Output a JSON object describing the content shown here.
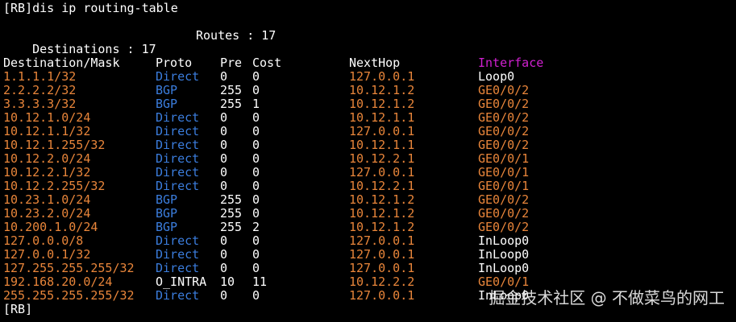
{
  "command_line": "[RB]dis ip routing-table",
  "summary": {
    "destinations": "Destinations : 17",
    "routes": "Routes : 17"
  },
  "headers": {
    "destination": "Destination/Mask",
    "proto": "Proto",
    "pre": "Pre",
    "cost": "Cost",
    "nexthop": "NextHop",
    "interface": "Interface"
  },
  "rows": [
    {
      "dest": "1.1.1.1/32",
      "proto": "Direct",
      "pre": "0",
      "cost": "0",
      "nexthop": "127.0.0.1",
      "iface": "Loop0"
    },
    {
      "dest": "2.2.2.2/32",
      "proto": "BGP",
      "pre": "255",
      "cost": "0",
      "nexthop": "10.12.1.2",
      "iface": "GE0/0/2"
    },
    {
      "dest": "3.3.3.3/32",
      "proto": "BGP",
      "pre": "255",
      "cost": "1",
      "nexthop": "10.12.1.2",
      "iface": "GE0/0/2"
    },
    {
      "dest": "10.12.1.0/24",
      "proto": "Direct",
      "pre": "0",
      "cost": "0",
      "nexthop": "10.12.1.1",
      "iface": "GE0/0/2"
    },
    {
      "dest": "10.12.1.1/32",
      "proto": "Direct",
      "pre": "0",
      "cost": "0",
      "nexthop": "127.0.0.1",
      "iface": "GE0/0/2"
    },
    {
      "dest": "10.12.1.255/32",
      "proto": "Direct",
      "pre": "0",
      "cost": "0",
      "nexthop": "10.12.1.1",
      "iface": "GE0/0/2"
    },
    {
      "dest": "10.12.2.0/24",
      "proto": "Direct",
      "pre": "0",
      "cost": "0",
      "nexthop": "10.12.2.1",
      "iface": "GE0/0/1"
    },
    {
      "dest": "10.12.2.1/32",
      "proto": "Direct",
      "pre": "0",
      "cost": "0",
      "nexthop": "127.0.0.1",
      "iface": "GE0/0/1"
    },
    {
      "dest": "10.12.2.255/32",
      "proto": "Direct",
      "pre": "0",
      "cost": "0",
      "nexthop": "10.12.2.1",
      "iface": "GE0/0/1"
    },
    {
      "dest": "10.23.1.0/24",
      "proto": "BGP",
      "pre": "255",
      "cost": "0",
      "nexthop": "10.12.1.2",
      "iface": "GE0/0/2"
    },
    {
      "dest": "10.23.2.0/24",
      "proto": "BGP",
      "pre": "255",
      "cost": "0",
      "nexthop": "10.12.1.2",
      "iface": "GE0/0/2"
    },
    {
      "dest": "10.200.1.0/24",
      "proto": "BGP",
      "pre": "255",
      "cost": "2",
      "nexthop": "10.12.1.2",
      "iface": "GE0/0/2"
    },
    {
      "dest": "127.0.0.0/8",
      "proto": "Direct",
      "pre": "0",
      "cost": "0",
      "nexthop": "127.0.0.1",
      "iface": "InLoop0"
    },
    {
      "dest": "127.0.0.1/32",
      "proto": "Direct",
      "pre": "0",
      "cost": "0",
      "nexthop": "127.0.0.1",
      "iface": "InLoop0"
    },
    {
      "dest": "127.255.255.255/32",
      "proto": "Direct",
      "pre": "0",
      "cost": "0",
      "nexthop": "127.0.0.1",
      "iface": "InLoop0"
    },
    {
      "dest": "192.168.20.0/24",
      "proto": "O_INTRA",
      "pre": "10",
      "cost": "11",
      "nexthop": "10.12.2.2",
      "iface": "GE0/0/1"
    },
    {
      "dest": "255.255.255.255/32",
      "proto": "Direct",
      "pre": "0",
      "cost": "0",
      "nexthop": "127.0.0.1",
      "iface": "InLoop0"
    }
  ],
  "prompt": "[RB]",
  "watermark": "掘金技术社区 @ 不做菜鸟的网工",
  "colors": {
    "background": "#000000",
    "default_text": "#ffffff",
    "destination_text": "#e8853a",
    "protocol_direct_bgp": "#3b7ddd",
    "protocol_ospf": "#ffffff",
    "nexthop_text": "#e8853a",
    "interface_header": "#d020d0",
    "interface_ge": "#e8853a",
    "interface_loop": "#ffffff"
  }
}
